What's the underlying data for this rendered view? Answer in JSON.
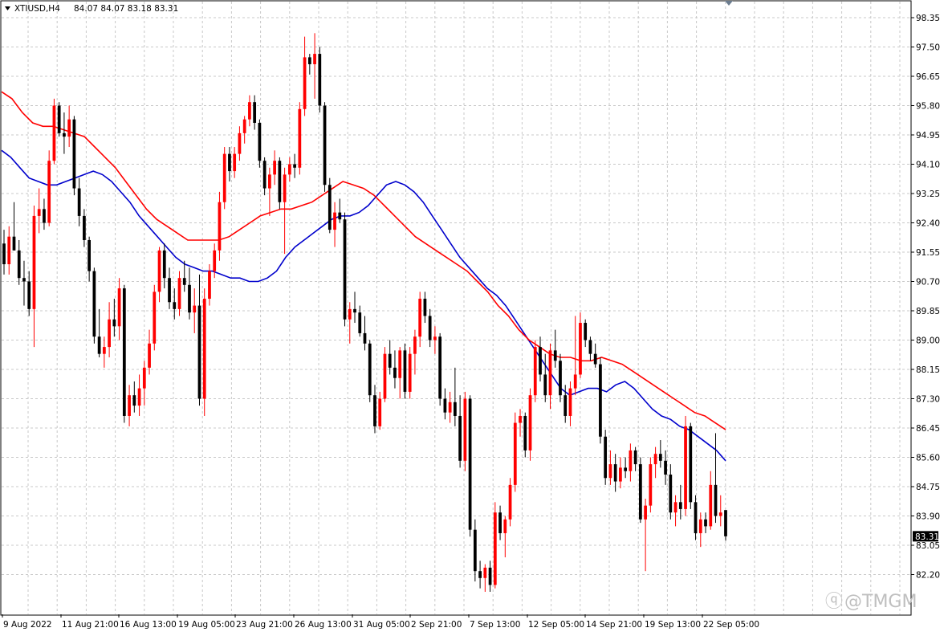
{
  "header": {
    "symbol_timeframe": "XTIUSD,H4",
    "ohlc": "84.07 84.07 83.18 83.31"
  },
  "price_axis": {
    "ticks": [
      "98.35",
      "97.50",
      "96.65",
      "95.80",
      "94.95",
      "94.10",
      "93.25",
      "92.40",
      "91.55",
      "90.70",
      "89.85",
      "89.00",
      "88.15",
      "87.30",
      "86.45",
      "85.60",
      "84.75",
      "83.90",
      "83.05",
      "82.20"
    ],
    "current_price": "83.31"
  },
  "time_axis": {
    "labels": [
      "9 Aug 2022",
      "11 Aug 21:00",
      "16 Aug 13:00",
      "19 Aug 05:00",
      "23 Aug 21:00",
      "26 Aug 13:00",
      "31 Aug 05:00",
      "2 Sep 21:00",
      "7 Sep 13:00",
      "12 Sep 05:00",
      "14 Sep 21:00",
      "19 Sep 13:00",
      "22 Sep 05:00"
    ]
  },
  "watermark": "@TMGM",
  "colors": {
    "bull": "#ff0000",
    "bear": "#000000",
    "ma_fast": "#0000cc",
    "ma_slow": "#ff0000",
    "grid": "#c8c8c8",
    "price_tag_bg": "#000000"
  },
  "chart_data": {
    "type": "candlestick",
    "ylim": [
      81.5,
      98.6
    ],
    "grid": true,
    "candles": [
      [
        91.8,
        92.2,
        90.9,
        91.2
      ],
      [
        91.2,
        92.3,
        90.9,
        92.0
      ],
      [
        92.0,
        93.0,
        91.6,
        91.6
      ],
      [
        91.6,
        91.9,
        90.6,
        90.8
      ],
      [
        90.8,
        91.3,
        90.0,
        90.7
      ],
      [
        90.7,
        91.0,
        89.7,
        89.9
      ],
      [
        89.9,
        92.9,
        88.8,
        92.6
      ],
      [
        92.6,
        93.4,
        92.1,
        92.8
      ],
      [
        92.8,
        93.1,
        92.2,
        92.4
      ],
      [
        92.4,
        94.5,
        92.3,
        94.2
      ],
      [
        94.2,
        96.0,
        94.1,
        95.8
      ],
      [
        95.8,
        95.9,
        94.9,
        95.0
      ],
      [
        95.0,
        95.6,
        94.4,
        94.9
      ],
      [
        94.9,
        95.8,
        94.6,
        95.4
      ],
      [
        95.4,
        95.5,
        93.2,
        93.4
      ],
      [
        93.4,
        93.7,
        92.3,
        92.6
      ],
      [
        92.6,
        92.8,
        91.7,
        91.9
      ],
      [
        91.9,
        92.0,
        90.7,
        91.0
      ],
      [
        91.0,
        91.1,
        88.9,
        89.1
      ],
      [
        89.1,
        89.9,
        88.5,
        88.6
      ],
      [
        88.6,
        89.1,
        88.2,
        88.8
      ],
      [
        88.8,
        90.1,
        88.5,
        89.6
      ],
      [
        89.6,
        90.2,
        89.1,
        89.4
      ],
      [
        89.4,
        90.8,
        89.0,
        90.5
      ],
      [
        90.5,
        90.6,
        86.6,
        86.8
      ],
      [
        86.8,
        87.7,
        86.5,
        87.4
      ],
      [
        87.4,
        87.8,
        86.9,
        87.1
      ],
      [
        87.1,
        88.0,
        86.8,
        87.6
      ],
      [
        87.6,
        88.4,
        87.1,
        88.2
      ],
      [
        88.2,
        89.3,
        88.0,
        88.9
      ],
      [
        88.9,
        90.6,
        88.7,
        90.4
      ],
      [
        90.4,
        91.7,
        90.1,
        91.6
      ],
      [
        91.6,
        91.8,
        90.5,
        90.8
      ],
      [
        90.8,
        91.1,
        89.9,
        90.1
      ],
      [
        90.1,
        90.5,
        89.6,
        89.9
      ],
      [
        89.9,
        91.0,
        89.7,
        90.8
      ],
      [
        90.8,
        91.3,
        90.4,
        90.6
      ],
      [
        90.6,
        91.1,
        89.6,
        89.8
      ],
      [
        89.8,
        90.5,
        89.2,
        90.0
      ],
      [
        90.0,
        90.9,
        87.1,
        87.3
      ],
      [
        87.3,
        90.5,
        86.8,
        90.2
      ],
      [
        90.2,
        91.2,
        90.0,
        91.0
      ],
      [
        91.0,
        91.8,
        90.8,
        91.6
      ],
      [
        91.6,
        93.3,
        91.3,
        93.0
      ],
      [
        93.0,
        94.6,
        92.8,
        94.4
      ],
      [
        94.4,
        94.6,
        93.6,
        93.9
      ],
      [
        93.9,
        94.6,
        93.7,
        94.4
      ],
      [
        94.4,
        95.2,
        94.2,
        95.0
      ],
      [
        95.0,
        95.5,
        94.7,
        95.4
      ],
      [
        95.4,
        96.1,
        95.2,
        95.9
      ],
      [
        95.9,
        96.1,
        95.1,
        95.3
      ],
      [
        95.3,
        95.4,
        94.0,
        94.2
      ],
      [
        94.2,
        94.3,
        93.2,
        93.4
      ],
      [
        93.4,
        94.0,
        92.6,
        93.8
      ],
      [
        93.8,
        94.5,
        93.5,
        94.2
      ],
      [
        94.2,
        94.3,
        92.8,
        93.0
      ],
      [
        93.0,
        94.0,
        91.5,
        93.8
      ],
      [
        93.8,
        94.3,
        93.6,
        94.1
      ],
      [
        94.1,
        94.4,
        93.7,
        94.0
      ],
      [
        94.0,
        95.9,
        93.8,
        95.7
      ],
      [
        95.7,
        97.8,
        95.5,
        97.2
      ],
      [
        97.2,
        97.3,
        96.7,
        97.0
      ],
      [
        97.0,
        97.9,
        96.0,
        97.3
      ],
      [
        97.3,
        97.5,
        95.6,
        95.8
      ],
      [
        95.8,
        95.9,
        93.3,
        93.5
      ],
      [
        93.5,
        93.7,
        92.1,
        92.2
      ],
      [
        92.2,
        93.0,
        91.7,
        92.7
      ],
      [
        92.7,
        93.1,
        92.4,
        92.5
      ],
      [
        92.5,
        92.7,
        89.4,
        89.6
      ],
      [
        89.6,
        90.1,
        88.9,
        89.9
      ],
      [
        89.9,
        90.4,
        89.5,
        89.8
      ],
      [
        89.8,
        90.0,
        89.1,
        89.2
      ],
      [
        89.2,
        89.7,
        88.7,
        88.9
      ],
      [
        88.9,
        89.0,
        87.2,
        87.4
      ],
      [
        87.4,
        87.7,
        86.3,
        86.5
      ],
      [
        86.5,
        87.5,
        86.4,
        87.3
      ],
      [
        87.3,
        88.8,
        87.2,
        88.6
      ],
      [
        88.6,
        89.0,
        88.0,
        88.2
      ],
      [
        88.2,
        88.7,
        87.6,
        87.9
      ],
      [
        87.9,
        88.8,
        87.3,
        88.7
      ],
      [
        88.7,
        88.9,
        87.3,
        87.5
      ],
      [
        87.5,
        88.8,
        87.3,
        88.6
      ],
      [
        88.6,
        89.3,
        88.0,
        89.1
      ],
      [
        89.1,
        90.4,
        88.8,
        90.2
      ],
      [
        90.2,
        90.4,
        89.5,
        89.7
      ],
      [
        89.7,
        89.9,
        88.8,
        89.0
      ],
      [
        89.0,
        89.4,
        88.6,
        89.1
      ],
      [
        89.1,
        89.2,
        87.1,
        87.3
      ],
      [
        87.3,
        87.6,
        86.7,
        86.9
      ],
      [
        86.9,
        87.5,
        86.6,
        87.2
      ],
      [
        87.2,
        88.2,
        86.5,
        86.8
      ],
      [
        86.8,
        87.4,
        85.3,
        85.5
      ],
      [
        85.5,
        87.5,
        85.2,
        87.3
      ],
      [
        87.3,
        87.4,
        83.3,
        83.5
      ],
      [
        83.5,
        83.8,
        82.0,
        82.3
      ],
      [
        82.3,
        82.6,
        81.8,
        82.1
      ],
      [
        82.1,
        82.5,
        81.7,
        82.4
      ],
      [
        82.4,
        82.6,
        81.7,
        81.9
      ],
      [
        81.9,
        84.3,
        81.8,
        84.0
      ],
      [
        84.0,
        84.2,
        83.2,
        83.4
      ],
      [
        83.4,
        83.9,
        82.7,
        83.8
      ],
      [
        83.8,
        85.0,
        83.6,
        84.8
      ],
      [
        84.8,
        86.9,
        84.6,
        86.6
      ],
      [
        86.6,
        87.0,
        86.2,
        86.8
      ],
      [
        86.8,
        86.9,
        85.6,
        85.8
      ],
      [
        85.8,
        87.6,
        85.5,
        87.4
      ],
      [
        87.4,
        89.0,
        87.2,
        88.8
      ],
      [
        88.8,
        89.1,
        87.8,
        88.0
      ],
      [
        88.0,
        88.6,
        87.2,
        87.4
      ],
      [
        87.4,
        88.9,
        87.0,
        88.7
      ],
      [
        88.7,
        89.3,
        88.2,
        88.4
      ],
      [
        88.4,
        88.6,
        87.2,
        87.4
      ],
      [
        87.4,
        87.7,
        86.6,
        86.8
      ],
      [
        86.8,
        87.8,
        86.5,
        87.6
      ],
      [
        87.6,
        89.7,
        87.4,
        88.0
      ],
      [
        88.0,
        89.8,
        87.9,
        89.5
      ],
      [
        89.5,
        89.6,
        88.8,
        89.0
      ],
      [
        89.0,
        89.1,
        88.4,
        88.6
      ],
      [
        88.6,
        88.9,
        88.2,
        88.3
      ],
      [
        88.3,
        88.5,
        86.0,
        86.2
      ],
      [
        86.2,
        86.4,
        84.8,
        85.0
      ],
      [
        85.0,
        85.8,
        84.8,
        85.4
      ],
      [
        85.4,
        85.7,
        84.6,
        84.9
      ],
      [
        84.9,
        85.6,
        84.7,
        85.3
      ],
      [
        85.3,
        85.6,
        85.0,
        85.2
      ],
      [
        85.2,
        86.0,
        84.9,
        85.8
      ],
      [
        85.8,
        85.9,
        85.2,
        85.4
      ],
      [
        85.4,
        85.6,
        83.7,
        83.8
      ],
      [
        83.8,
        84.4,
        82.3,
        84.2
      ],
      [
        84.2,
        85.6,
        84.0,
        85.4
      ],
      [
        85.4,
        85.9,
        85.0,
        85.7
      ],
      [
        85.7,
        86.1,
        85.3,
        85.5
      ],
      [
        85.5,
        85.8,
        84.8,
        85.1
      ],
      [
        85.1,
        85.4,
        83.8,
        84.0
      ],
      [
        84.0,
        84.5,
        83.6,
        84.3
      ],
      [
        84.3,
        84.8,
        83.8,
        84.1
      ],
      [
        84.1,
        86.8,
        83.9,
        86.5
      ],
      [
        86.5,
        86.6,
        84.1,
        84.3
      ],
      [
        84.3,
        84.5,
        83.2,
        83.4
      ],
      [
        83.4,
        84.0,
        83.0,
        83.8
      ],
      [
        83.8,
        84.0,
        83.4,
        83.6
      ],
      [
        83.6,
        85.2,
        83.5,
        84.8
      ],
      [
        84.8,
        86.3,
        83.7,
        83.9
      ],
      [
        83.9,
        84.5,
        83.6,
        84.0
      ],
      [
        84.07,
        84.07,
        83.18,
        83.31
      ]
    ],
    "ma_fast": [
      94.5,
      94.3,
      94.0,
      93.7,
      93.6,
      93.5,
      93.5,
      93.6,
      93.7,
      93.8,
      93.9,
      93.8,
      93.6,
      93.3,
      93.0,
      92.6,
      92.3,
      92.0,
      91.7,
      91.4,
      91.2,
      91.1,
      91.0,
      91.0,
      90.9,
      90.8,
      90.8,
      90.7,
      90.7,
      90.8,
      91.0,
      91.4,
      91.7,
      91.9,
      92.1,
      92.3,
      92.5,
      92.6,
      92.6,
      92.7,
      92.9,
      93.2,
      93.5,
      93.6,
      93.5,
      93.3,
      93.0,
      92.6,
      92.2,
      91.8,
      91.4,
      91.1,
      90.8,
      90.5,
      90.3,
      90.0,
      89.6,
      89.2,
      88.8,
      88.4,
      88.0,
      87.6,
      87.4,
      87.5,
      87.6,
      87.6,
      87.5,
      87.7,
      87.8,
      87.6,
      87.3,
      87.0,
      86.8,
      86.7,
      86.5,
      86.4,
      86.2,
      86.0,
      85.8,
      85.5
    ],
    "ma_slow": [
      96.2,
      96.0,
      95.6,
      95.3,
      95.2,
      95.2,
      95.1,
      95.0,
      94.9,
      94.6,
      94.3,
      94.0,
      93.6,
      93.2,
      92.8,
      92.5,
      92.3,
      92.1,
      91.9,
      91.9,
      91.9,
      91.9,
      92.0,
      92.2,
      92.4,
      92.6,
      92.7,
      92.8,
      92.8,
      92.9,
      93.0,
      93.2,
      93.4,
      93.6,
      93.5,
      93.4,
      93.2,
      92.9,
      92.6,
      92.3,
      92.0,
      91.8,
      91.6,
      91.4,
      91.2,
      91.0,
      90.7,
      90.4,
      90.0,
      89.7,
      89.3,
      89.0,
      88.8,
      88.6,
      88.5,
      88.5,
      88.4,
      88.4,
      88.5,
      88.4,
      88.3,
      88.1,
      87.9,
      87.7,
      87.5,
      87.3,
      87.1,
      86.9,
      86.8,
      86.6,
      86.4
    ]
  }
}
